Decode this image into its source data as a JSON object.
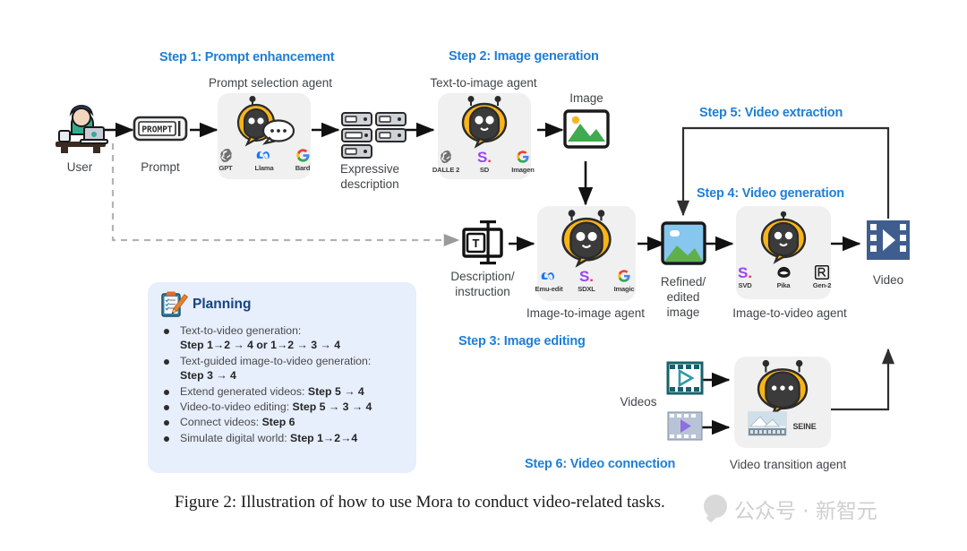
{
  "figure": {
    "caption": "Figure 2: Illustration of how to use Mora to conduct video-related tasks.",
    "watermark": "公众号 · 新智元",
    "accent_blue": "#1f7fd4",
    "planning_bg": "#e7eefc",
    "card_bg": "#f0f0f0"
  },
  "steps": [
    {
      "id": "step1",
      "label": "Step 1: Prompt enhancement"
    },
    {
      "id": "step2",
      "label": "Step 2: Image generation"
    },
    {
      "id": "step3",
      "label": "Step 3: Image editing"
    },
    {
      "id": "step4",
      "label": "Step 4: Video generation"
    },
    {
      "id": "step5",
      "label": "Step 5: Video extraction"
    },
    {
      "id": "step6",
      "label": "Step 6: Video connection"
    }
  ],
  "nodes": {
    "user": "User",
    "prompt": "Prompt",
    "prompt_token": "PROMPT",
    "prompt_selection_agent": "Prompt selection agent",
    "expressive_description_line1": "Expressive",
    "expressive_description_line2": "description",
    "text_to_image_agent": "Text-to-image agent",
    "image": "Image",
    "description_instruction_line1": "Description/",
    "description_instruction_line2": "instruction",
    "description_instruction_glyph": "T",
    "image_to_image_agent": "Image-to-image agent",
    "refined_edited_image_line1": "Refined/",
    "refined_edited_image_line2": "edited",
    "refined_edited_image_line3": "image",
    "image_to_video_agent": "Image-to-video agent",
    "video": "Video",
    "videos": "Videos",
    "video_transition_agent": "Video transition agent"
  },
  "agents": {
    "prompt_selection": {
      "title": "Prompt selection agent",
      "models": [
        {
          "name": "GPT",
          "icon": "openai-logo"
        },
        {
          "name": "Llama",
          "icon": "meta-logo"
        },
        {
          "name": "Bard",
          "icon": "google-logo"
        }
      ]
    },
    "text_to_image": {
      "title": "Text-to-image agent",
      "models": [
        {
          "name": "DALLE 2",
          "icon": "openai-logo"
        },
        {
          "name": "SD",
          "icon": "stability-logo"
        },
        {
          "name": "Imagen",
          "icon": "google-logo"
        }
      ]
    },
    "image_to_image": {
      "title": "Image-to-image agent",
      "models": [
        {
          "name": "Emu-edit",
          "icon": "meta-logo"
        },
        {
          "name": "SDXL",
          "icon": "stability-logo"
        },
        {
          "name": "Imagic",
          "icon": "google-logo"
        }
      ]
    },
    "image_to_video": {
      "title": "Image-to-video agent",
      "models": [
        {
          "name": "SVD",
          "icon": "stability-logo"
        },
        {
          "name": "Pika",
          "icon": "pika-logo"
        },
        {
          "name": "Gen-2",
          "icon": "runway-logo"
        }
      ]
    },
    "video_transition": {
      "title": "Video transition agent",
      "models": [
        {
          "name": "SEINE",
          "icon": "seine-logo"
        }
      ]
    }
  },
  "planning": {
    "title": "Planning",
    "icon": "clipboard-pencil-icon",
    "items": [
      {
        "text": "Text-to-video generation:",
        "bold_tail": "",
        "second_line": "Step 1→2 → 4  or 1→2 → 3 → 4"
      },
      {
        "text": "Text-guided image-to-video generation:",
        "bold_tail": "",
        "second_line": "Step 3 → 4"
      },
      {
        "text": "Extend generated videos:",
        "bold_tail": "  Step 5 → 4",
        "second_line": ""
      },
      {
        "text": "Video-to-video editing:",
        "bold_tail": "  Step 5 → 3 → 4",
        "second_line": ""
      },
      {
        "text": "Connect videos:",
        "bold_tail": " Step 6",
        "second_line": ""
      },
      {
        "text": "Simulate digital world:",
        "bold_tail": " Step 1→2→4",
        "second_line": ""
      }
    ]
  }
}
